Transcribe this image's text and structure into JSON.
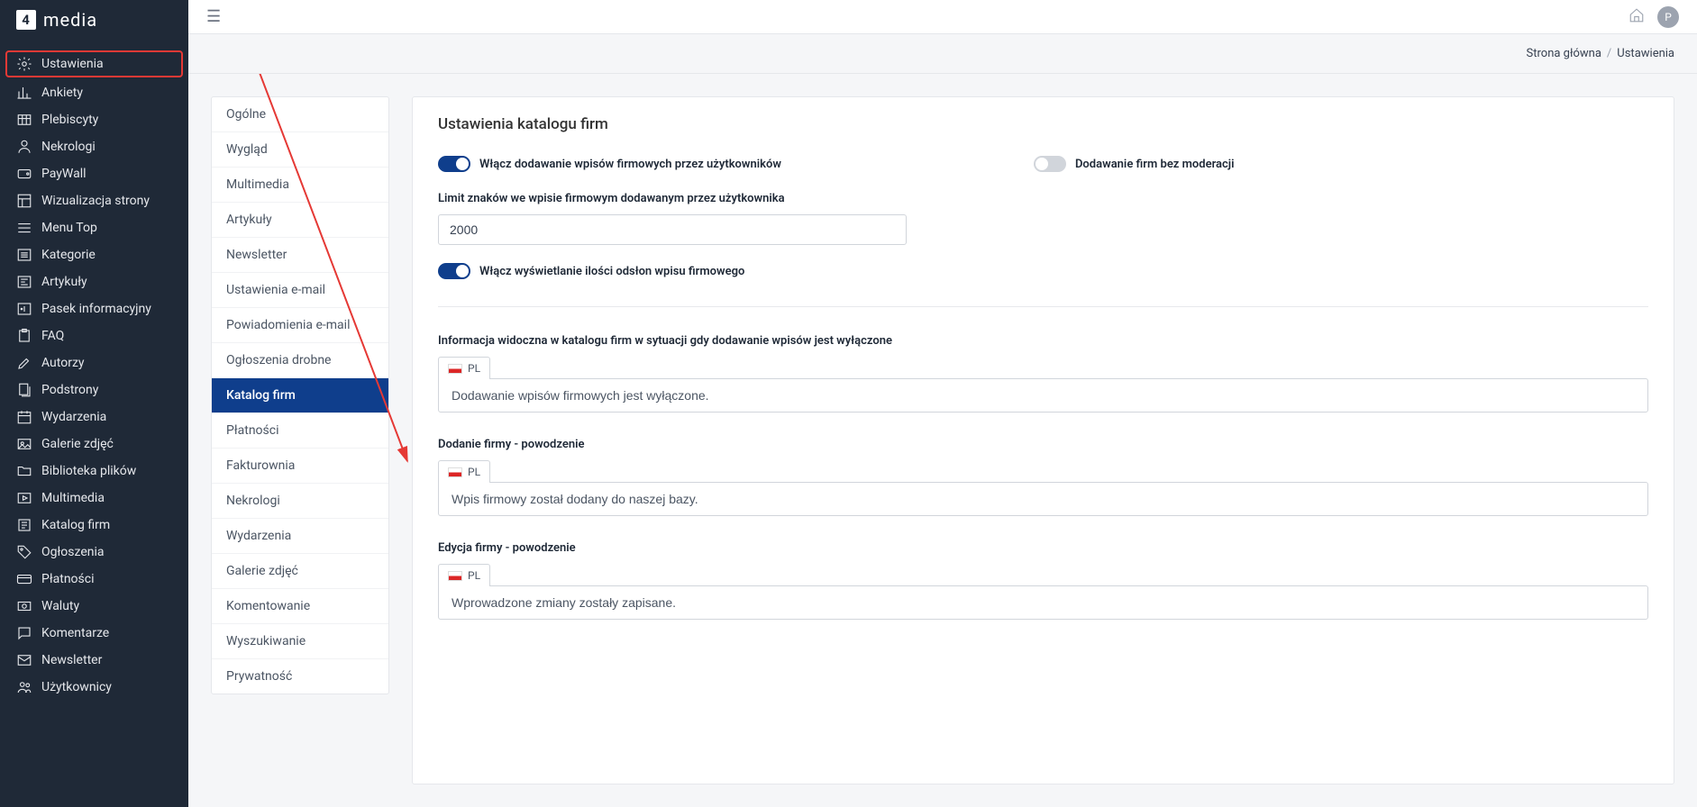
{
  "brand": "media",
  "avatar_initial": "P",
  "breadcrumb": {
    "home": "Strona główna",
    "current": "Ustawienia",
    "sep": "/"
  },
  "sidebar": {
    "items": [
      {
        "label": "Ustawienia",
        "icon": "gear",
        "highlighted": true
      },
      {
        "label": "Ankiety",
        "icon": "chart"
      },
      {
        "label": "Plebiscyty",
        "icon": "table"
      },
      {
        "label": "Nekrologi",
        "icon": "person"
      },
      {
        "label": "PayWall",
        "icon": "wallet"
      },
      {
        "label": "Wizualizacja strony",
        "icon": "layout"
      },
      {
        "label": "Menu Top",
        "icon": "menu"
      },
      {
        "label": "Kategorie",
        "icon": "list"
      },
      {
        "label": "Artykuły",
        "icon": "news"
      },
      {
        "label": "Pasek informacyjny",
        "icon": "info"
      },
      {
        "label": "FAQ",
        "icon": "clipboard"
      },
      {
        "label": "Autorzy",
        "icon": "pen"
      },
      {
        "label": "Podstrony",
        "icon": "pages"
      },
      {
        "label": "Wydarzenia",
        "icon": "calendar"
      },
      {
        "label": "Galerie zdjęć",
        "icon": "gallery"
      },
      {
        "label": "Biblioteka plików",
        "icon": "folder"
      },
      {
        "label": "Multimedia",
        "icon": "media"
      },
      {
        "label": "Katalog firm",
        "icon": "catalog"
      },
      {
        "label": "Ogłoszenia",
        "icon": "tag"
      },
      {
        "label": "Płatności",
        "icon": "credit"
      },
      {
        "label": "Waluty",
        "icon": "currency"
      },
      {
        "label": "Komentarze",
        "icon": "comment"
      },
      {
        "label": "Newsletter",
        "icon": "mail"
      },
      {
        "label": "Użytkownicy",
        "icon": "users"
      }
    ]
  },
  "subnav": {
    "items": [
      {
        "label": "Ogólne"
      },
      {
        "label": "Wygląd"
      },
      {
        "label": "Multimedia"
      },
      {
        "label": "Artykuły"
      },
      {
        "label": "Newsletter"
      },
      {
        "label": "Ustawienia e-mail"
      },
      {
        "label": "Powiadomienia e-mail"
      },
      {
        "label": "Ogłoszenia drobne"
      },
      {
        "label": "Katalog firm",
        "active": true
      },
      {
        "label": "Płatności"
      },
      {
        "label": "Fakturownia"
      },
      {
        "label": "Nekrologi"
      },
      {
        "label": "Wydarzenia"
      },
      {
        "label": "Galerie zdjęć"
      },
      {
        "label": "Komentowanie"
      },
      {
        "label": "Wyszukiwanie"
      },
      {
        "label": "Prywatność"
      }
    ]
  },
  "panel": {
    "title": "Ustawienia katalogu firm",
    "toggle_enable_add": "Włącz dodawanie wpisów firmowych przez użytkowników",
    "toggle_no_moderation": "Dodawanie firm bez moderacji",
    "limit_label": "Limit znaków we wpisie firmowym dodawanym przez użytkownika",
    "limit_value": "2000",
    "toggle_views": "Włącz wyświetlanie ilości odsłon wpisu firmowego",
    "info_disabled_label": "Informacja widoczna w katalogu firm w sytuacji gdy dodawanie wpisów jest wyłączone",
    "info_disabled_value": "Dodawanie wpisów firmowych jest wyłączone.",
    "add_success_label": "Dodanie firmy - powodzenie",
    "add_success_value": "Wpis firmowy został dodany do naszej bazy.",
    "edit_success_label": "Edycja firmy - powodzenie",
    "edit_success_value": "Wprowadzone zmiany zostały zapisane.",
    "lang_tab": "PL"
  }
}
